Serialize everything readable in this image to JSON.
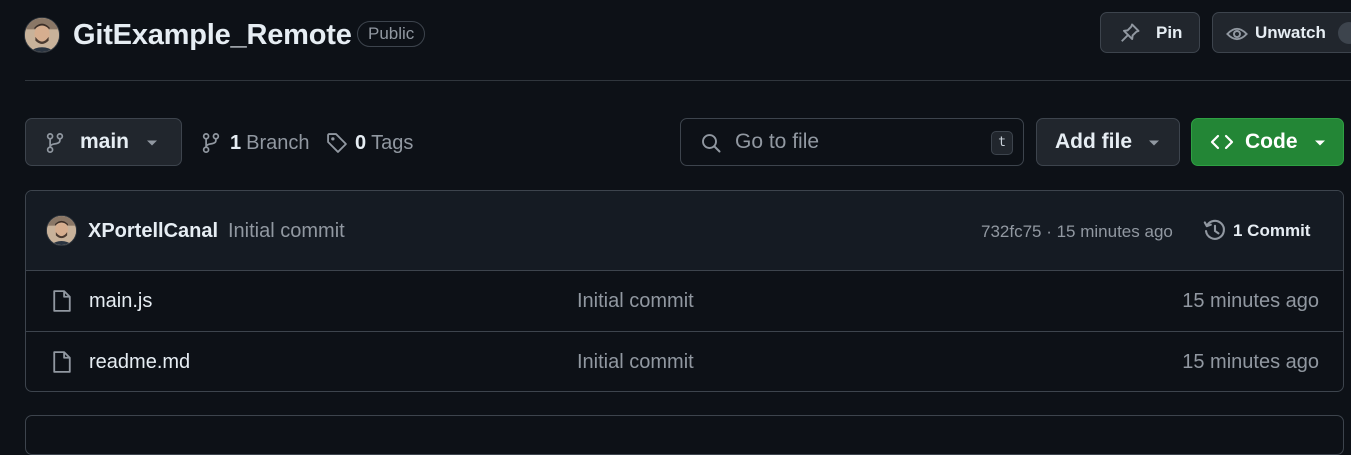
{
  "header": {
    "repo_name": "GitExample_Remote",
    "visibility_badge": "Public",
    "pin_label": "Pin",
    "unwatch_label": "Unwatch"
  },
  "toolbar": {
    "branch_name": "main",
    "branch_count": "1",
    "branch_label": "Branch",
    "tag_count": "0",
    "tag_label": "Tags",
    "search_placeholder": "Go to file",
    "search_shortcut": "t",
    "add_file_label": "Add file",
    "code_label": "Code"
  },
  "latest_commit": {
    "author": "XPortellCanal",
    "message": "Initial commit",
    "sha_time": "732fc75 · 15 minutes ago",
    "commit_count": "1 Commit"
  },
  "files": [
    {
      "name": "main.js",
      "message": "Initial commit",
      "time": "15 minutes ago"
    },
    {
      "name": "readme.md",
      "message": "Initial commit",
      "time": "15 minutes ago"
    }
  ],
  "colors": {
    "background": "#0d1117",
    "code_button": "#238636",
    "border": "#3d444d"
  }
}
